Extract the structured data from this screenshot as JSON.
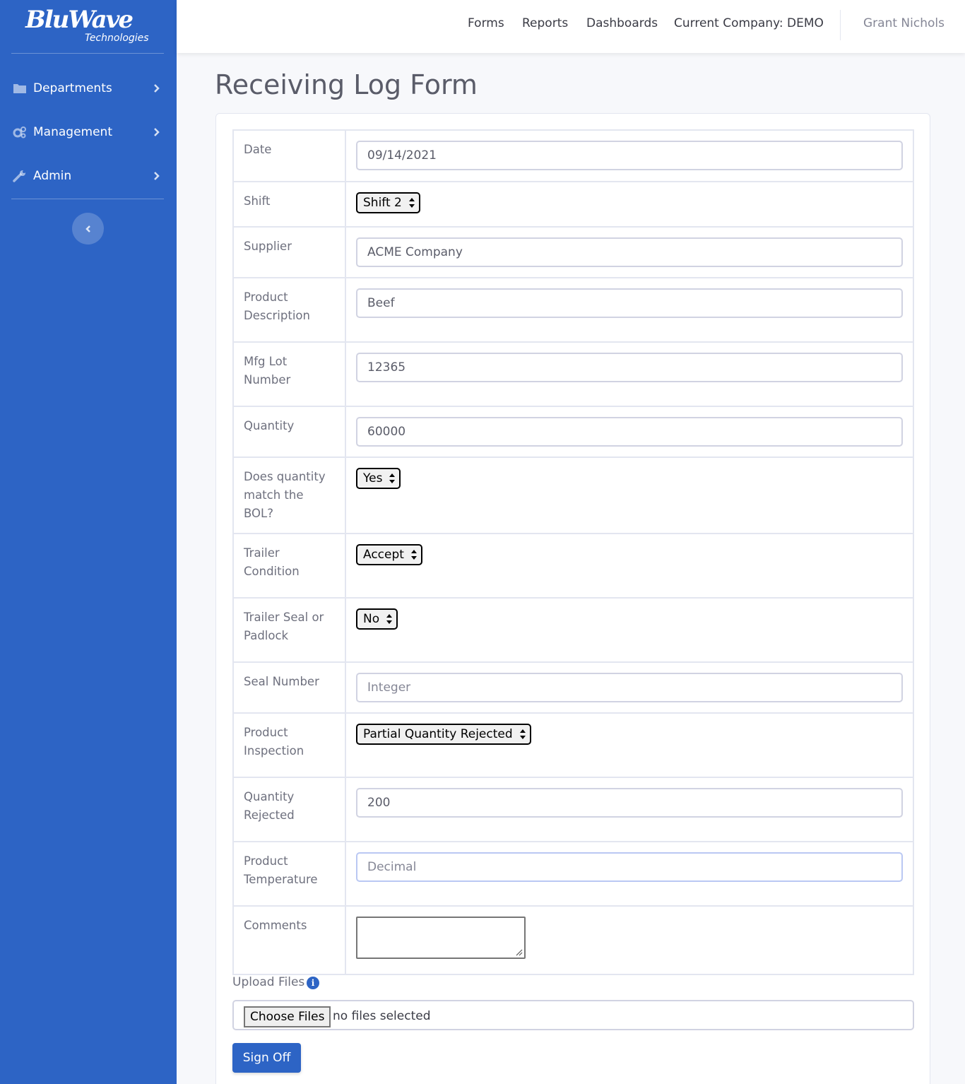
{
  "brand": {
    "name": "BluWave",
    "sub": "Technologies"
  },
  "sidebar": {
    "items": [
      {
        "label": "Departments",
        "icon": "folder-icon"
      },
      {
        "label": "Management",
        "icon": "gears-icon"
      },
      {
        "label": "Admin",
        "icon": "wrench-icon"
      }
    ]
  },
  "topnav": {
    "links": [
      "Forms",
      "Reports",
      "Dashboards",
      "Current Company: DEMO"
    ],
    "user": "Grant Nichols"
  },
  "page": {
    "title": "Receiving Log Form"
  },
  "form": {
    "date": {
      "label": "Date",
      "value": "09/14/2021"
    },
    "shift": {
      "label": "Shift",
      "value": "Shift 2"
    },
    "supplier": {
      "label": "Supplier",
      "value": "ACME Company"
    },
    "product_description": {
      "label": "Product Description",
      "value": "Beef"
    },
    "mfg_lot": {
      "label": "Mfg Lot Number",
      "value": "12365"
    },
    "quantity": {
      "label": "Quantity",
      "value": "60000"
    },
    "bol_match": {
      "label": "Does quantity match the BOL?",
      "value": "Yes"
    },
    "trailer_condition": {
      "label": "Trailer Condition",
      "value": "Accept"
    },
    "trailer_seal": {
      "label": "Trailer Seal or Padlock",
      "value": "No"
    },
    "seal_number": {
      "label": "Seal Number",
      "value": "",
      "placeholder": "Integer"
    },
    "product_inspection": {
      "label": "Product Inspection",
      "value": "Partial Quantity Rejected"
    },
    "quantity_rejected": {
      "label": "Quantity Rejected",
      "value": "200"
    },
    "product_temperature": {
      "label": "Product Temperature",
      "value": "",
      "placeholder": "Decimal"
    },
    "comments": {
      "label": "Comments",
      "value": ""
    }
  },
  "upload": {
    "label": "Upload Files",
    "button": "Choose Files",
    "status": "no files selected"
  },
  "actions": {
    "signoff": "Sign Off"
  },
  "colors": {
    "sidebar": "#2d64c5",
    "accent": "#2d64c5"
  }
}
